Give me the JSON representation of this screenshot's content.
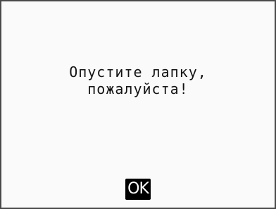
{
  "dialog": {
    "message_line1": "Опустите лапку,",
    "message_line2": "пожалуйста!",
    "ok_label": "OK"
  }
}
